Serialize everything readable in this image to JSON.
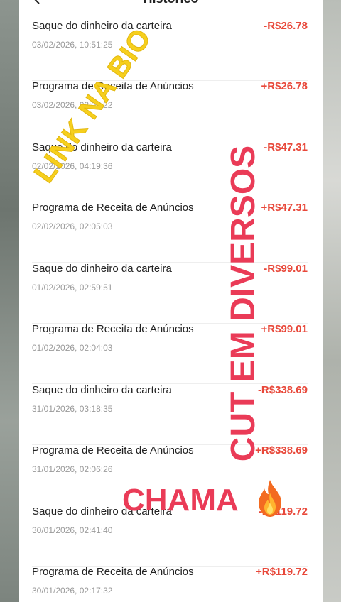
{
  "header": {
    "title": "Histórico"
  },
  "transactions": [
    {
      "title": "Saque do dinheiro da carteira",
      "date": "03/02/2026, 10:51:25",
      "amount": "-R$26.78"
    },
    {
      "title": "Programa de Receita de Anúncios",
      "date": "03/02/2026, 02:07:22",
      "amount": "+R$26.78"
    },
    {
      "title": "Saque do dinheiro da carteira",
      "date": "02/02/2026, 04:19:36",
      "amount": "-R$47.31"
    },
    {
      "title": "Programa de Receita de Anúncios",
      "date": "02/02/2026, 02:05:03",
      "amount": "+R$47.31"
    },
    {
      "title": "Saque do dinheiro da carteira",
      "date": "01/02/2026, 02:59:51",
      "amount": "-R$99.01"
    },
    {
      "title": "Programa de Receita de Anúncios",
      "date": "01/02/2026, 02:04:03",
      "amount": "+R$99.01"
    },
    {
      "title": "Saque do dinheiro da carteira",
      "date": "31/01/2026, 03:18:35",
      "amount": "-R$338.69"
    },
    {
      "title": "Programa de Receita de Anúncios",
      "date": "31/01/2026, 02:06:26",
      "amount": "+R$338.69"
    },
    {
      "title": "Saque do dinheiro da carteira",
      "date": "30/01/2026, 02:41:40",
      "amount": "-R$119.72"
    },
    {
      "title": "Programa de Receita de Anúncios",
      "date": "30/01/2026, 02:17:32",
      "amount": "+R$119.72"
    }
  ],
  "overlay": {
    "link_text": "LINK NA BIO",
    "cut_text": "CUT EM DIVERSOS",
    "chama_text": "CHAMA",
    "fire_icon": "fire-icon"
  },
  "colors": {
    "amount": "#e8483a",
    "overlay_yellow": "#f6cf1d",
    "overlay_red": "#ea3b57"
  }
}
